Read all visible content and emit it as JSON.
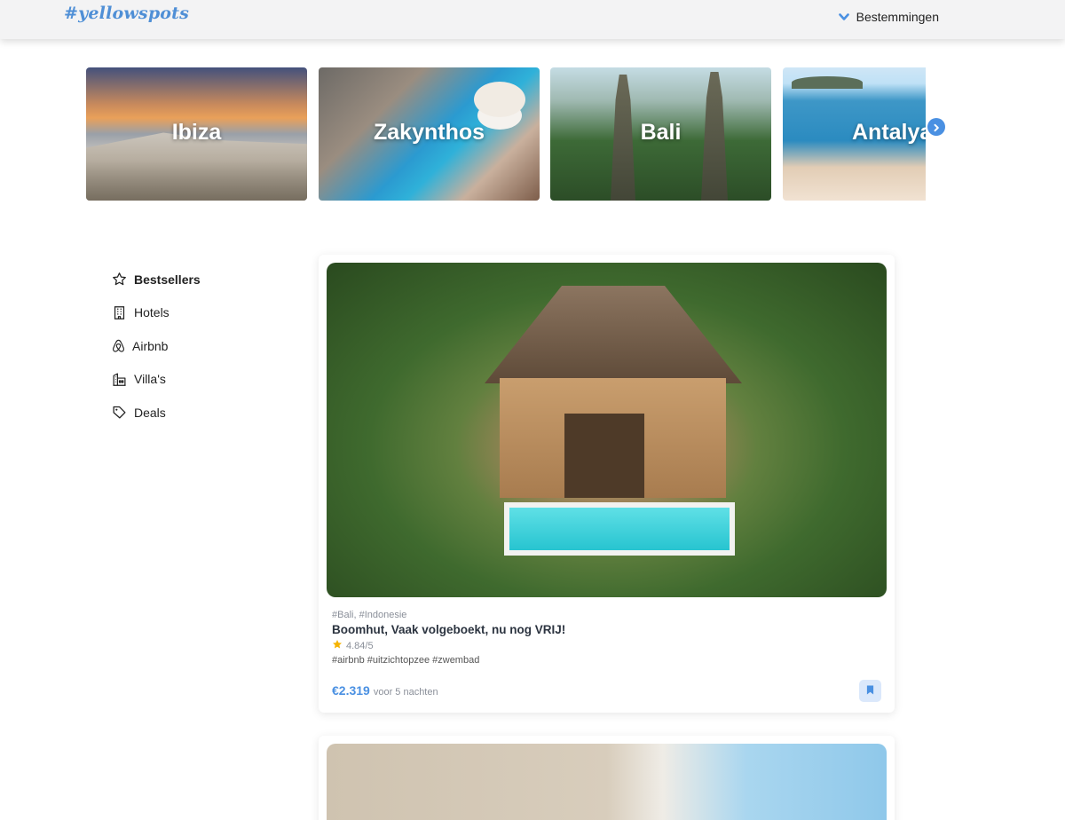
{
  "header": {
    "logo_hash": "#",
    "logo_text": "yellowspots",
    "destinations_label": "Bestemmingen"
  },
  "destinations": [
    {
      "name": "Ibiza"
    },
    {
      "name": "Zakynthos"
    },
    {
      "name": "Bali"
    },
    {
      "name": "Antalya"
    }
  ],
  "sidebar": {
    "items": [
      {
        "label": "Bestsellers",
        "icon": "star-icon",
        "active": true
      },
      {
        "label": "Hotels",
        "icon": "building-icon",
        "active": false
      },
      {
        "label": "Airbnb",
        "icon": "airbnb-icon",
        "active": false
      },
      {
        "label": "Villa's",
        "icon": "villa-icon",
        "active": false
      },
      {
        "label": "Deals",
        "icon": "tag-icon",
        "active": false
      }
    ]
  },
  "listings": [
    {
      "location": "#Bali, #Indonesie",
      "title": "Boomhut, Vaak volgeboekt, nu nog VRIJ!",
      "rating": "4.84/5",
      "tags": "#airbnb #uitzichtopzee #zwembad",
      "price": "€2.319",
      "price_note": "voor 5 nachten"
    }
  ],
  "colors": {
    "accent": "#4a90e2",
    "star": "#f5b301",
    "bookmark_bg": "#dbe8fb"
  }
}
